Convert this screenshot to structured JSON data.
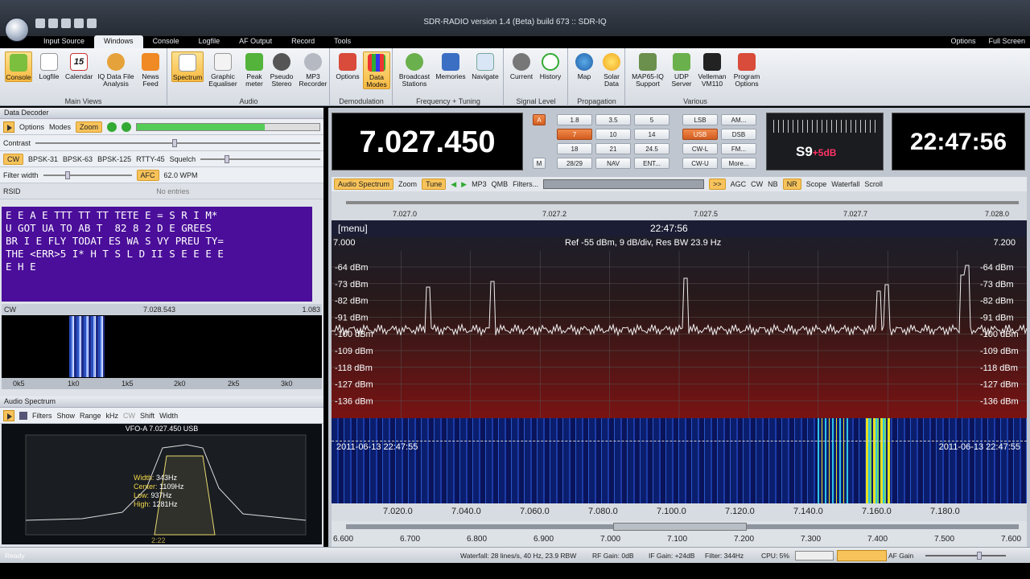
{
  "app": {
    "title": "SDR-RADIO version 1.4 (Beta) build 673 :: SDR-IQ"
  },
  "menu_tabs": [
    "Input Source",
    "Windows",
    "Console",
    "Logfile",
    "AF Output",
    "Record",
    "Tools"
  ],
  "top_right": {
    "options": "Options",
    "fullscreen": "Full Screen"
  },
  "ribbon": {
    "main_views": {
      "label": "Main Views",
      "items": [
        "Console",
        "Logfile",
        "Calendar",
        "IQ Data File Analysis",
        "News Feed"
      ],
      "calendar_day": "15"
    },
    "audio": {
      "label": "Audio",
      "items": [
        "Spectrum",
        "Graphic Equaliser",
        "Peak meter",
        "Pseudo Stereo",
        "MP3 Recorder"
      ]
    },
    "demod": {
      "label": "Demodulation",
      "items": [
        "Options",
        "Data Modes"
      ]
    },
    "freq": {
      "label": "Frequency + Tuning",
      "items": [
        "Broadcast Stations",
        "Memories",
        "Navigate"
      ]
    },
    "signal": {
      "label": "Signal Level",
      "items": [
        "Current",
        "History"
      ]
    },
    "prop": {
      "label": "Propagation",
      "items": [
        "Map",
        "Solar Data"
      ]
    },
    "various": {
      "label": "Various",
      "items": [
        "MAP65-IQ Support",
        "UDP Server",
        "Velleman VM110",
        "Program Options"
      ]
    }
  },
  "decoder": {
    "title": "Data Decoder",
    "toolbar": {
      "options": "Options",
      "modes": "Modes",
      "zoom": "Zoom"
    },
    "contrast": "Contrast",
    "modes": [
      "CW",
      "BPSK-31",
      "BPSK-63",
      "BPSK-125",
      "RTTY-45"
    ],
    "squelch": "Squelch",
    "filter": "Filter width",
    "afc": "AFC",
    "wpm": "62.0 WPM",
    "rsid": "RSID",
    "no_entries": "No entries",
    "text": "E E A E TTT TT TT TETE E = S R I M*\nU GOT UA TO AB T  82 8 2 D E GREES\nBR I E FLY TODAT ES WA S VY PREU TY=\nTHE <ERR>5 I* H T S L D II S E E E E\nE H E",
    "cw_label": "CW",
    "cw_freq": "7.028.543",
    "cw_val": "1.083",
    "cw_ticks": [
      "0k5",
      "1k0",
      "1k5",
      "2k0",
      "2k5",
      "3k0"
    ]
  },
  "audiospec": {
    "title": "Audio Spectrum",
    "toolbar": [
      "Filters",
      "Show",
      "Range",
      "kHz",
      "CW",
      "Shift",
      "Width"
    ],
    "vfo": "VFO-A  7.027.450  USB",
    "width_l": "Width:",
    "width_v": "343Hz",
    "center_l": "Center:",
    "center_v": "1109Hz",
    "low_l": "Low:",
    "low_v": "937Hz",
    "high_l": "High:",
    "high_v": "1281Hz",
    "time": "2:22"
  },
  "console": {
    "frequency": "7.027.450",
    "a_btn": "A",
    "m_btn": "M",
    "bands": [
      "1.8",
      "3.5",
      "5",
      "7",
      "10",
      "14",
      "18",
      "21",
      "24.5",
      "28/29",
      "NAV",
      "ENT..."
    ],
    "active_band": "7",
    "modes": [
      "LSB",
      "AM...",
      "USB",
      "DSB",
      "CW-L",
      "FM...",
      "CW-U",
      "More..."
    ],
    "active_mode": "USB",
    "smeter": "S9",
    "smeter_plus": "+5dB",
    "clock": "22:47:56"
  },
  "spectrum_toolbar": [
    "Audio Spectrum",
    "Zoom",
    "Tune",
    "MP3",
    "QMB",
    "Filters...",
    ">>",
    "AGC",
    "CW",
    "NB",
    "NR",
    "Scope",
    "Waterfall",
    "Scroll"
  ],
  "tune_scale": [
    "7.027.0",
    "7.027.2",
    "7.027.5",
    "7.027.7",
    "7.028.0"
  ],
  "spectrum": {
    "menu": "[menu]",
    "time": "22:47:56",
    "left_freq": "7.000",
    "right_freq": "7.200",
    "ref": "Ref -55 dBm,  9 dB/div,  Res BW 23.9 Hz",
    "levels": [
      "-64 dBm",
      "-73 dBm",
      "-82 dBm",
      "-91 dBm",
      "-100 dBm",
      "-109 dBm",
      "-118 dBm",
      "-127 dBm",
      "-136 dBm"
    ]
  },
  "waterfall": {
    "timestamp": "2011-06-13  22:47:55",
    "axis": [
      "7.020.0",
      "7.040.0",
      "7.060.0",
      "7.080.0",
      "7.100.0",
      "7.120.0",
      "7.140.0",
      "7.160.0",
      "7.180.0"
    ]
  },
  "bottom_scale": [
    "6.600",
    "6.700",
    "6.800",
    "6.900",
    "7.000",
    "7.100",
    "7.200",
    "7.300",
    "7.400",
    "7.500",
    "7.600"
  ],
  "status": {
    "ready": "Ready",
    "waterfall": "Waterfall: 28 lines/s, 40 Hz, 23.9 RBW",
    "rf": "RF Gain: 0dB",
    "if": "IF Gain: +24dB",
    "filter": "Filter: 344Hz",
    "cpu": "CPU: 5%",
    "af": "AF Gain"
  }
}
